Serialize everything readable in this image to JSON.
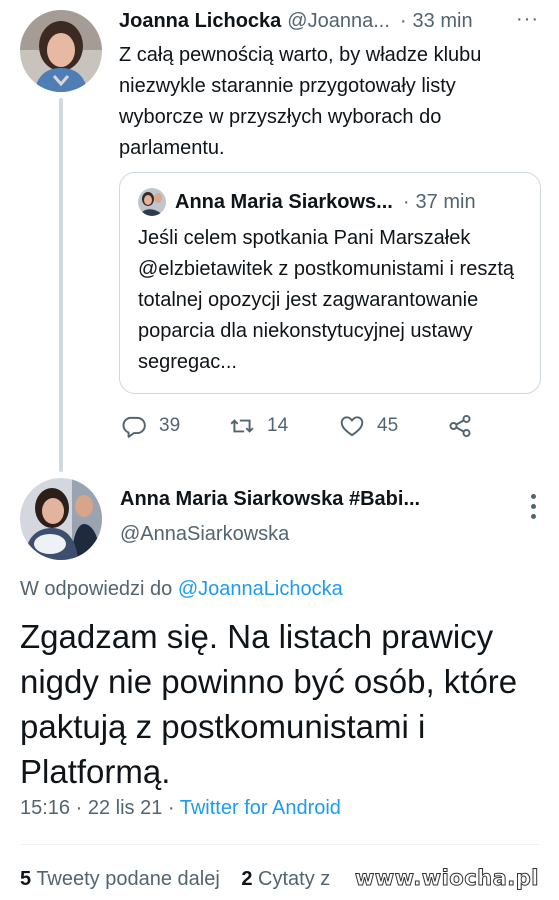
{
  "tweet1": {
    "author_name": "Joanna Lichocka",
    "handle": "@Joanna...",
    "separator": "·",
    "time": "33 min",
    "more": "···",
    "text": "Z całą pewnością warto, by władze klubu niezwykle starannie przygotowały listy wyborcze w przyszłych wyborach do parlamentu.",
    "quote": {
      "author_name": "Anna Maria Siarkows...",
      "separator": "·",
      "time": "37 min",
      "text": "Jeśli celem spotkania Pani Marszałek @elzbietawitek z postkomunistami i resztą totalnej opozycji jest zagwarantowanie poparcia dla niekonstytucyjnej ustawy segregac..."
    },
    "actions": {
      "replies": "39",
      "retweets": "14",
      "likes": "45"
    },
    "colors": {
      "text": "#0f1419",
      "secondary": "#536471",
      "border": "#cfd9de"
    }
  },
  "tweet2": {
    "author_name": "Anna Maria Siarkowska #Babi...",
    "handle": "@AnnaSiarkowska",
    "reply_prefix": "W odpowiedzi do",
    "reply_to": "@JoannaLichocka",
    "text": "Zgadzam się. Na listach prawicy nigdy nie powinno być osób, które paktują z postkomunistami i Platformą.",
    "meta_time": "15:16 · 22 lis 21 · ",
    "meta_source": "Twitter for Android",
    "stats": {
      "retweets_count": "5",
      "retweets_label": " Tweety podane dalej",
      "quotes_count": "2",
      "quotes_label": " Cytaty z"
    },
    "colors": {
      "link": "#1d9bf0"
    }
  },
  "watermark": "www.wiocha.pl"
}
